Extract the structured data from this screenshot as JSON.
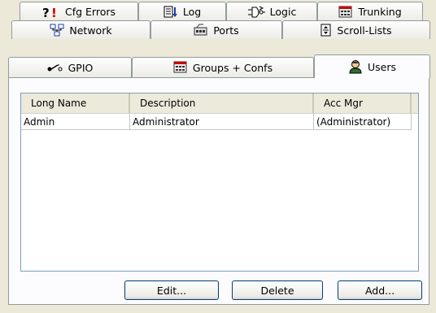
{
  "tabs": {
    "cfg_errors": "Cfg Errors",
    "log": "Log",
    "logic": "Logic",
    "trunking": "Trunking",
    "network": "Network",
    "ports": "Ports",
    "scroll_lists": "Scroll-Lists",
    "gpio": "GPIO",
    "groups_confs": "Groups + Confs",
    "users": "Users",
    "active": "Users"
  },
  "icons": {
    "cfg_errors": "error-icon",
    "log": "log-icon",
    "logic": "logic-gate-icon",
    "trunking": "trunking-icon",
    "network": "network-icon",
    "ports": "ports-icon",
    "scroll_lists": "scroll-list-icon",
    "gpio": "gpio-icon",
    "groups_confs": "groups-icon",
    "users": "user-icon"
  },
  "table": {
    "columns": [
      "Long Name",
      "Description",
      "Acc Mgr"
    ],
    "rows": [
      [
        "Admin",
        "Administrator",
        "(Administrator)"
      ]
    ]
  },
  "buttons": {
    "edit": "Edit...",
    "delete": "Delete",
    "add": "Add..."
  },
  "colors": {
    "window_bg": "#ece9d8",
    "tab_border": "#919b9c",
    "panel_bg": "#fcfcfe",
    "button_border": "#003c74",
    "error_red": "#cc0000"
  }
}
